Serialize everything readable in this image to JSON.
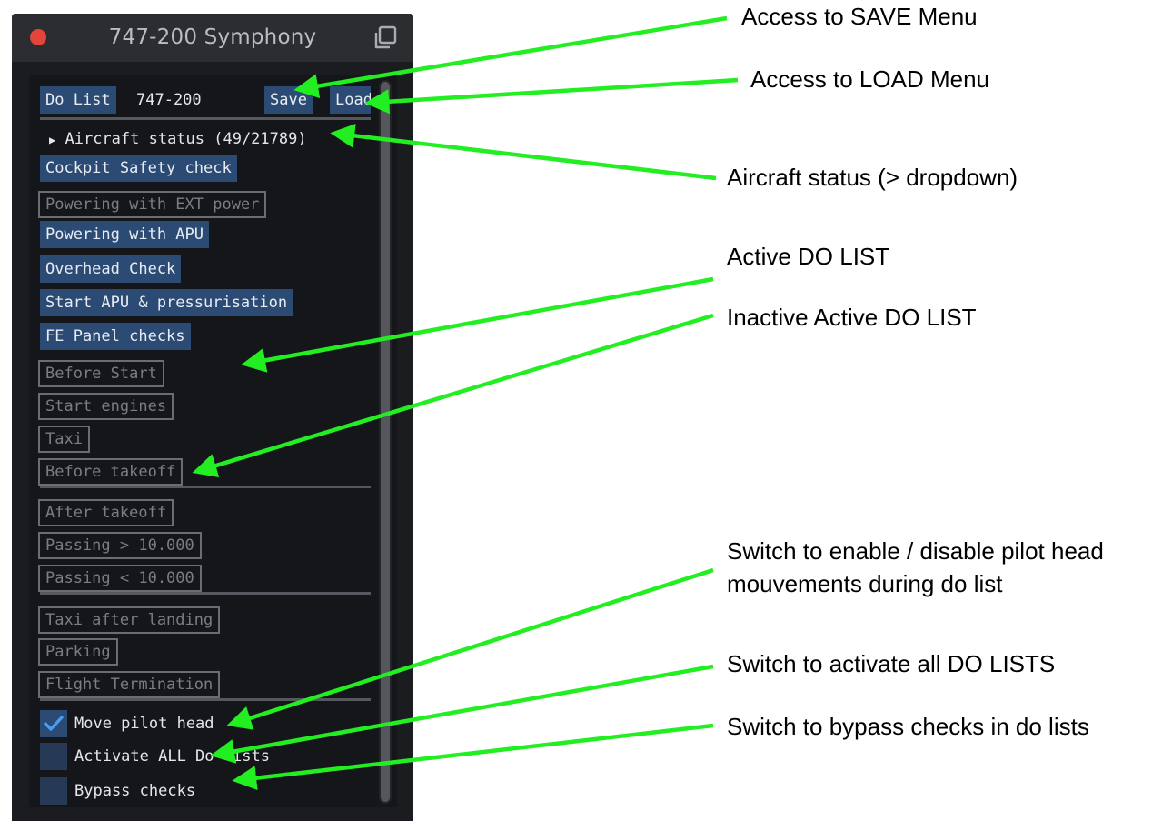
{
  "window": {
    "title": "747-200 Symphony",
    "icons": {
      "close": "close-dot-icon",
      "popout": "popout-window-icon"
    }
  },
  "toolbar": {
    "do_list_button": "Do List",
    "aircraft_model": "747-200",
    "save_button": "Save",
    "load_button": "Load"
  },
  "aircraft_status": {
    "arrow": "▶",
    "label": "Aircraft status (49/21789)"
  },
  "do_lists": [
    {
      "label": "Cockpit Safety check",
      "active": true
    },
    {
      "label": "Powering with EXT power",
      "active": false
    },
    {
      "label": "Powering with APU",
      "active": true
    },
    {
      "label": "Overhead Check",
      "active": true
    },
    {
      "label": "Start APU & pressurisation",
      "active": true
    },
    {
      "label": "FE Panel checks",
      "active": true
    },
    {
      "label": "Before Start",
      "active": false
    },
    {
      "label": "Start engines",
      "active": false
    },
    {
      "label": "Taxi",
      "active": false
    },
    {
      "label": "Before takeoff",
      "active": false
    },
    {
      "label": "After takeoff",
      "active": false
    },
    {
      "label": "Passing > 10.000",
      "active": false
    },
    {
      "label": "Passing < 10.000",
      "active": false
    },
    {
      "label": "Taxi after landing",
      "active": false
    },
    {
      "label": "Parking",
      "active": false
    },
    {
      "label": "Flight Termination",
      "active": false
    }
  ],
  "options": [
    {
      "label": "Move pilot head",
      "checked": true
    },
    {
      "label": "Activate ALL Do lists",
      "checked": false
    },
    {
      "label": "Bypass checks",
      "checked": false
    }
  ],
  "annotations": {
    "save": "Access to SAVE Menu",
    "load": "Access to LOAD Menu",
    "status": "Aircraft status (> dropdown)",
    "active": "Active DO LIST",
    "inactive": "Inactive Active DO LIST",
    "head_line1": "Switch to enable / disable pilot head",
    "head_line2": "mouvements during do list",
    "activate_all": "Switch to activate all DO LISTS",
    "bypass": "Switch to bypass checks in do lists"
  },
  "colors": {
    "arrow": "#22ee22",
    "active_button": "#2c4b74",
    "window_bg": "#1a1c20",
    "close_dot": "#e2453c"
  }
}
